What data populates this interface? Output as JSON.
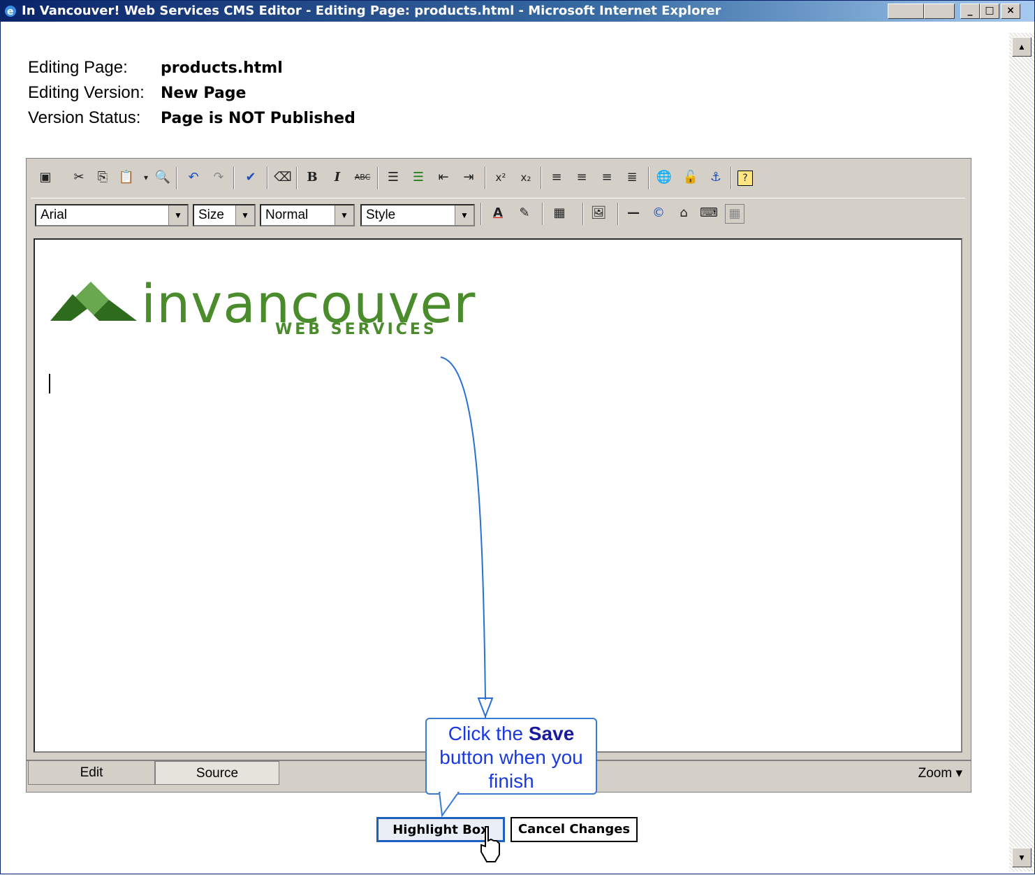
{
  "window": {
    "title": "In Vancouver! Web Services CMS Editor - Editing Page: products.html - Microsoft Internet Explorer",
    "buttons": {
      "minimize": "_",
      "maximize": "□",
      "close": "×"
    }
  },
  "info": {
    "page_label": "Editing Page:",
    "page_value": "products.html",
    "version_label": "Editing Version:",
    "version_value": "New Page",
    "status_label": "Version Status:",
    "status_value": "Page is NOT Published"
  },
  "toolbar2": {
    "font": "Arial",
    "size": "Size",
    "format": "Normal",
    "style": "Style"
  },
  "content": {
    "logo_text": "invancouver",
    "logo_sub": "WEB SERVICES"
  },
  "tabs": {
    "edit": "Edit",
    "source": "Source",
    "zoom": "Zoom ▾"
  },
  "actions": {
    "save": "Highlight Box",
    "cancel": "Cancel Changes"
  },
  "callout": {
    "line1_pre": "Click the ",
    "line1_bold": "Save",
    "line2": "button when you",
    "line3": "finish"
  },
  "colors": {
    "logo_green": "#4a8b2c",
    "callout_blue": "#3a7bd5",
    "titlebar": "#0a246a"
  }
}
